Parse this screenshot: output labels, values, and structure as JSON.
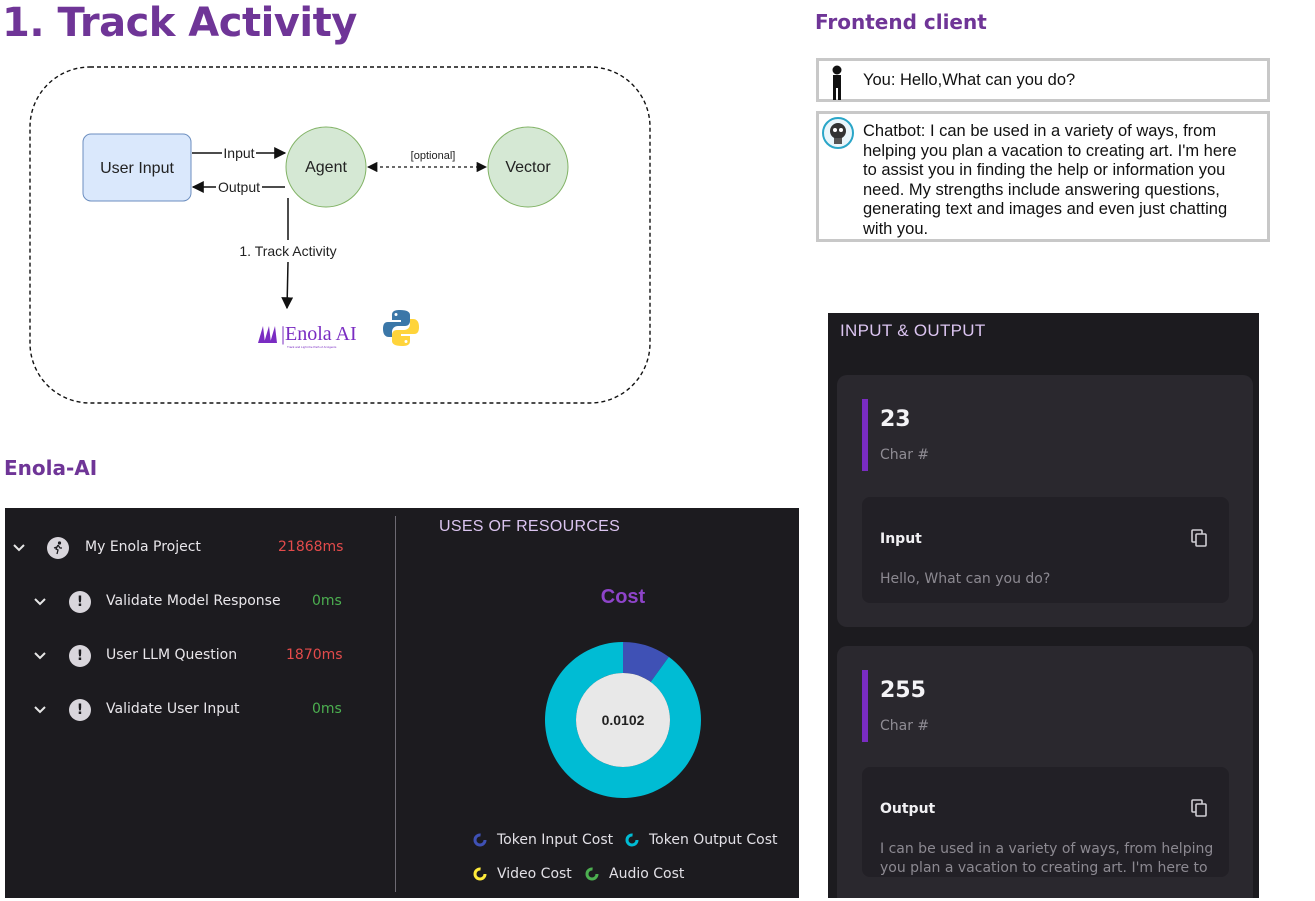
{
  "main_title": "1. Track Activity",
  "frontend_title": "Frontend client",
  "enola_title": "Enola-AI",
  "diagram": {
    "user_input": "User Input",
    "agent": "Agent",
    "vector": "Vector",
    "input_label": "Input",
    "output_label": "Output",
    "optional_label": "[optional]",
    "track_label": "1. Track Activity",
    "logo_text": "|Enola AI",
    "logo_tagline": "Track and Light the Path of AI Agents"
  },
  "chat": {
    "user_message": "You: Hello,What can you do?",
    "bot_lines": [
      "Chatbot: I can be used in a variety of ways, from",
      "helping you plan a vacation to creating art. I'm here",
      "to assist you in finding the help or information you",
      "need. My strengths include answering questions,",
      "generating text and images and even just chatting",
      "with you."
    ]
  },
  "trace": {
    "rows": [
      {
        "name": "My Enola Project",
        "time": "21868ms",
        "time_color": "#e34b4b"
      },
      {
        "name": "Validate Model Response",
        "time": "0ms",
        "time_color": "#4caf50"
      },
      {
        "name": "User LLM Question",
        "time": "1870ms",
        "time_color": "#e34b4b"
      },
      {
        "name": "Validate User Input",
        "time": "0ms",
        "time_color": "#4caf50"
      }
    ],
    "status_glyph": "!"
  },
  "resources": {
    "title": "USES OF RESOURCES",
    "cost_title": "Cost",
    "cost_value": "0.0102",
    "legend": [
      {
        "label": "Token Input Cost",
        "color": "#3f51b5"
      },
      {
        "label": "Token Output Cost",
        "color": "#00bcd4"
      },
      {
        "label": "Video Cost",
        "color": "#ffeb3b"
      },
      {
        "label": "Audio Cost",
        "color": "#4caf50"
      }
    ]
  },
  "chart_data": {
    "type": "pie",
    "title": "Cost",
    "center_label": "0.0102",
    "categories": [
      "Token Input Cost",
      "Token Output Cost",
      "Video Cost",
      "Audio Cost"
    ],
    "values": [
      0.1,
      0.9,
      0,
      0
    ],
    "colors": [
      "#3f51b5",
      "#00bcd4",
      "#ffeb3b",
      "#4caf50"
    ],
    "legend_position": "bottom"
  },
  "io": {
    "title": "INPUT & OUTPUT",
    "input": {
      "count": "23",
      "count_label": "Char #",
      "label": "Input",
      "value": "Hello, What can you do?"
    },
    "output": {
      "count": "255",
      "count_label": "Char #",
      "label": "Output",
      "value_lines": [
        "I can be used in a variety of ways, from helping",
        "you plan a vacation to creating art. I'm here to"
      ]
    }
  }
}
